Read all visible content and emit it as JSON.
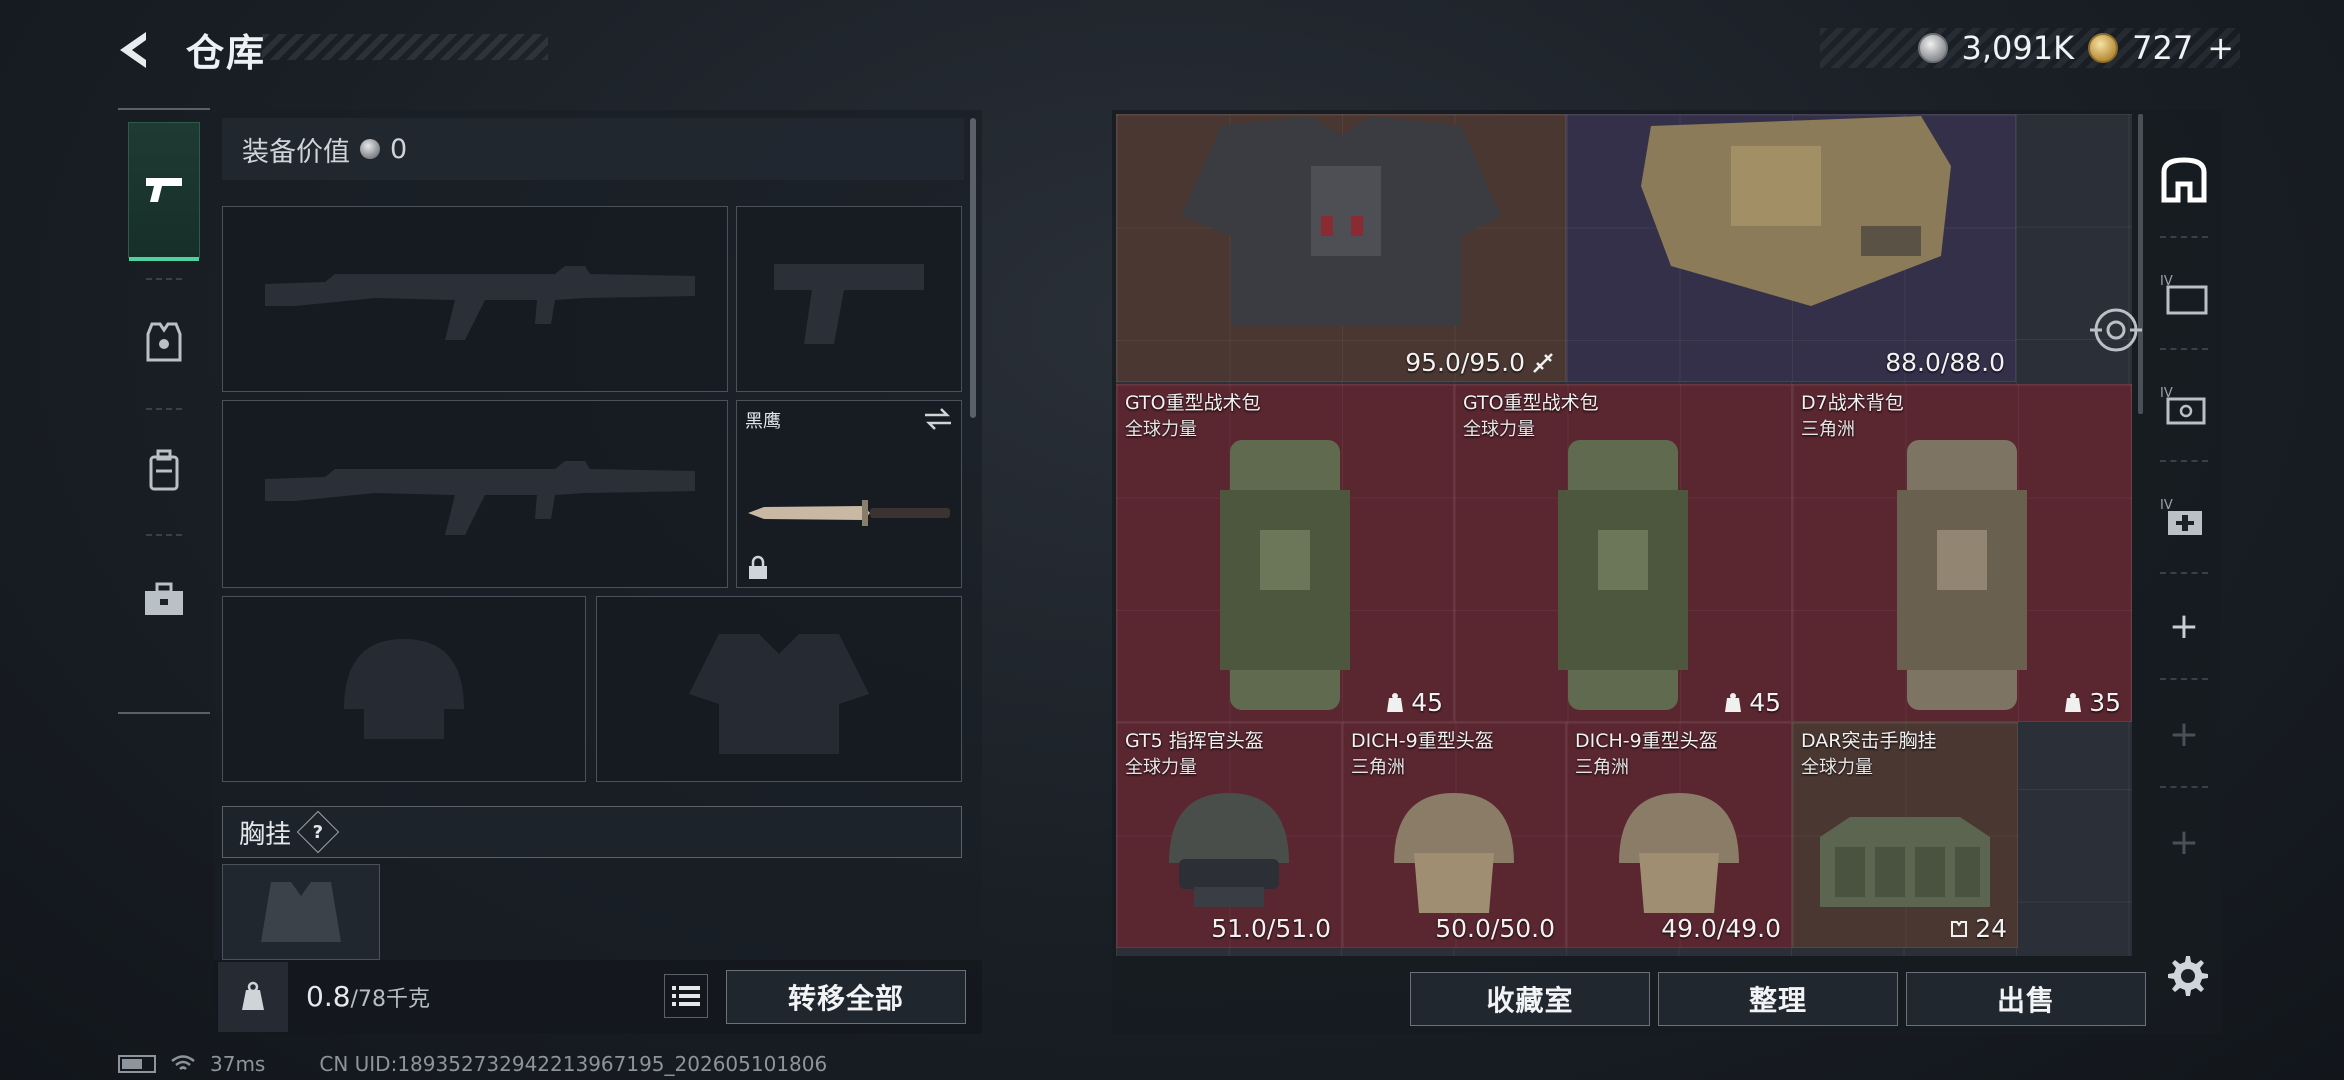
{
  "header": {
    "title": "仓库"
  },
  "currency": {
    "silver": "3,091K",
    "gold": "727"
  },
  "left": {
    "equip_value_label": "装备价值",
    "equip_value": "0",
    "melee_name": "黑鹰",
    "chest_label": "胸挂",
    "help": "?",
    "weight": "0.8",
    "weight_cap": "/78千克",
    "transfer_all": "转移全部"
  },
  "stash": {
    "items": [
      {
        "name": "",
        "sub": "",
        "value": "95.0/95.0",
        "color": "brown"
      },
      {
        "name": "",
        "sub": "",
        "value": "88.0/88.0",
        "color": "purple"
      },
      {
        "name": "GTO重型战术包",
        "sub": "全球力量",
        "value": "45",
        "color": "red"
      },
      {
        "name": "GTO重型战术包",
        "sub": "全球力量",
        "value": "45",
        "color": "red"
      },
      {
        "name": "D7战术背包",
        "sub": "三角洲",
        "value": "35",
        "color": "red"
      },
      {
        "name": "GT5 指挥官头盔",
        "sub": "全球力量",
        "value": "51.0/51.0",
        "color": "red"
      },
      {
        "name": "DICH-9重型头盔",
        "sub": "三角洲",
        "value": "50.0/50.0",
        "color": "red"
      },
      {
        "name": "DICH-9重型头盔",
        "sub": "三角洲",
        "value": "49.0/49.0",
        "color": "red"
      },
      {
        "name": "DAR突击手胸挂",
        "sub": "全球力量",
        "value": "24",
        "color": "brown"
      }
    ],
    "buttons": {
      "collection": "收藏室",
      "sort": "整理",
      "sell": "出售"
    }
  },
  "status": {
    "ping": "37ms",
    "uid": "CN UID:1893527329422139671​95_202605101806"
  },
  "colors": {
    "accent": "#4fd1a0",
    "red_rarity": "#5a2630",
    "purple_rarity": "#34304a",
    "brown_rarity": "#4a3732"
  }
}
